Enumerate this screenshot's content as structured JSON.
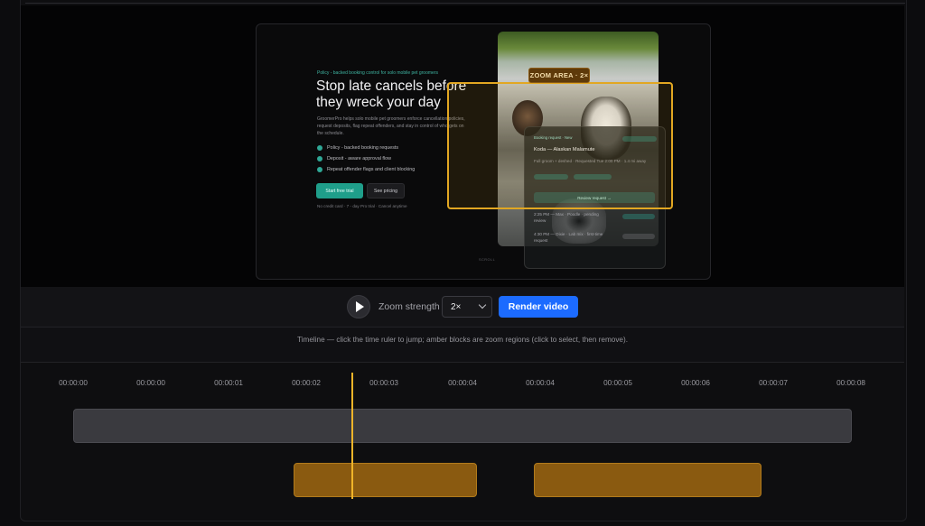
{
  "preview": {
    "landing": {
      "eyebrow": "Policy - backed booking control for solo mobile pet groomers",
      "headline": "Stop late cancels before they wreck your day",
      "description": "GroomerPro helps solo mobile pet groomers enforce cancellation policies, request deposits, flag repeat offenders, and stay in control of who gets on the schedule.",
      "features": [
        "Policy - backed booking requests",
        "Deposit - aware approval flow",
        "Repeat offender flags and client blocking"
      ],
      "primary_cta": "Start free trial",
      "secondary_cta": "See pricing",
      "fine_print": "No credit card · 7 - day Pro trial · Cancel anytime",
      "scroll_hint": "SCROLL"
    },
    "app_panel": {
      "status": "Booking request · New",
      "title": "Koda — Alaskan Malamute",
      "detail": "Full groom + deshed · Requested Tue 2:00 PM · 1.4 mi away",
      "rows": [
        "2:25 PM — Max · Poodle · pending review",
        "4:30 PM — Dixie · Lab mix · first-time request"
      ],
      "button": "Review request →"
    },
    "zoom_label": "ZOOM AREA · 2×"
  },
  "controls": {
    "zoom_strength_label": "Zoom strength",
    "zoom_value": "2×",
    "render_label": "Render video"
  },
  "timeline": {
    "hint": "Timeline — click the time ruler to jump; amber blocks are zoom regions (click to select, then remove).",
    "ticks": [
      "00:00:00",
      "00:00:00",
      "00:00:01",
      "00:00:02",
      "00:00:03",
      "00:00:04",
      "00:00:04",
      "00:00:05",
      "00:00:06",
      "00:00:07",
      "00:00:08"
    ],
    "zoom_regions": 2,
    "accent_color": "#f0b429"
  }
}
